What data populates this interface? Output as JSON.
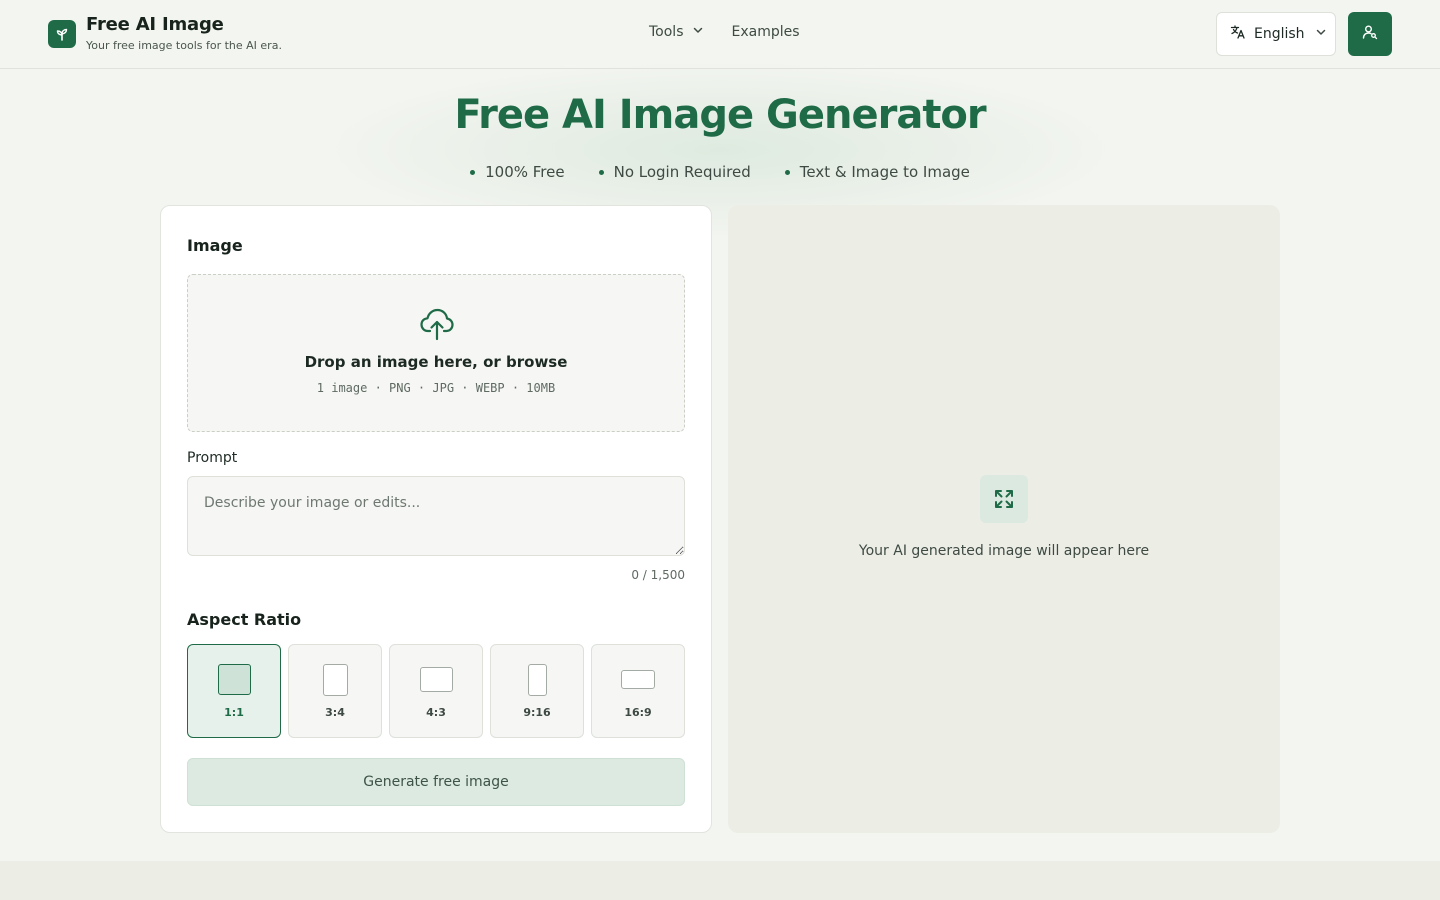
{
  "header": {
    "brand_title": "Free AI Image",
    "brand_subtitle": "Your free image tools for the AI era.",
    "nav": [
      {
        "label": "Tools",
        "has_dropdown": true
      },
      {
        "label": "Examples",
        "has_dropdown": false
      }
    ],
    "language_label": "English"
  },
  "hero": {
    "title": "Free AI Image Generator",
    "features": [
      "100% Free",
      "No Login Required",
      "Text & Image to Image"
    ]
  },
  "form": {
    "image_section_title": "Image",
    "drop_main": "Drop an image here, or browse",
    "drop_sub": "1 image · PNG · JPG · WEBP · 10MB",
    "prompt_label": "Prompt",
    "prompt_placeholder": "Describe your image or edits...",
    "prompt_value": "",
    "counter": "0 / 1,500",
    "aspect_title": "Aspect Ratio",
    "ratios": [
      {
        "label": "1:1",
        "selected": true
      },
      {
        "label": "3:4",
        "selected": false
      },
      {
        "label": "4:3",
        "selected": false
      },
      {
        "label": "9:16",
        "selected": false
      },
      {
        "label": "16:9",
        "selected": false
      }
    ],
    "generate_label": "Generate free image"
  },
  "preview": {
    "placeholder_text": "Your AI generated image will appear here"
  },
  "colors": {
    "accent": "#1f6b47",
    "background": "#f3f5f0",
    "preview_bg": "#eceee6"
  },
  "icons": [
    "sprout-logo-icon",
    "chevron-down-icon",
    "translate-icon",
    "user-search-icon",
    "cloud-upload-icon",
    "expand-icon"
  ]
}
